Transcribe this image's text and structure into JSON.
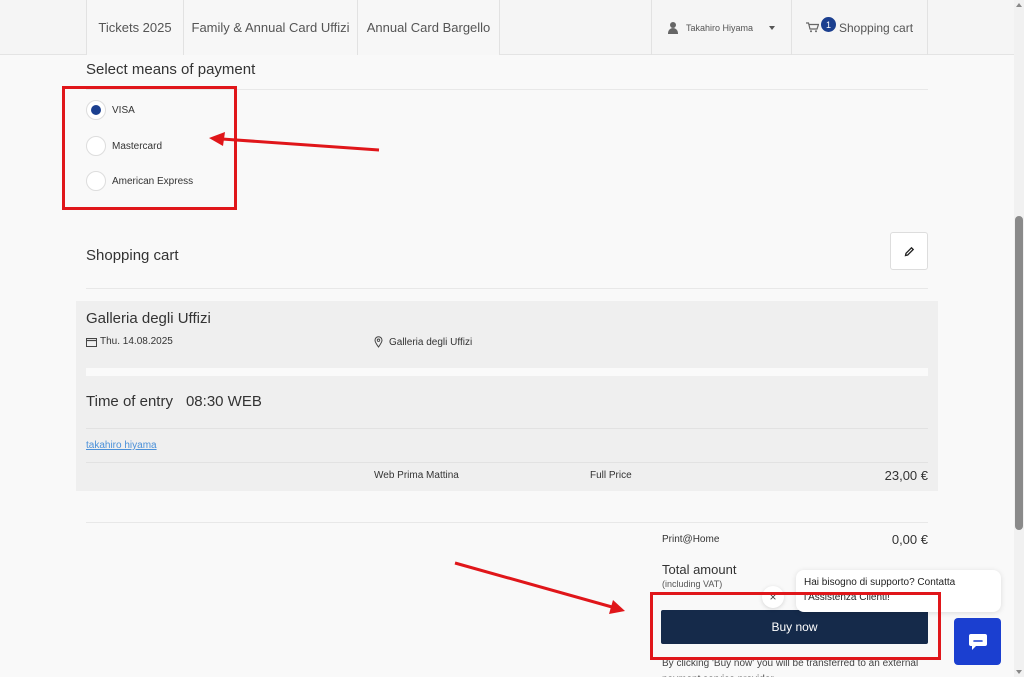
{
  "nav": {
    "tabs": [
      "Tickets 2025",
      "Family & Annual Card Uffizi",
      "Annual Card Bargello"
    ],
    "user_name": "Takahiro Hiyama",
    "cart_count": "1",
    "cart_label": "Shopping cart"
  },
  "payment": {
    "heading": "Select means of payment",
    "options": [
      "VISA",
      "Mastercard",
      "American Express"
    ],
    "selected": "VISA"
  },
  "cart": {
    "heading": "Shopping cart",
    "museum": "Galleria degli Uffizi",
    "date": "Thu. 14.08.2025",
    "location": "Galleria degli Uffizi",
    "entry_label": "Time of entry",
    "entry_time": "08:30 WEB",
    "holder": "takahiro hiyama",
    "ticket_type": "Web Prima Mattina",
    "rate": "Full Price",
    "price": "23,00 €"
  },
  "summary": {
    "print_label": "Print@Home",
    "print_price": "0,00 €",
    "total_label": "Total amount",
    "vat_note": "(including VAT)",
    "buy_label": "Buy now",
    "disclaimer": "By clicking 'Buy now' you will be transferred to an external payment service provider."
  },
  "support": {
    "message": "Hai bisogno di supporto? Contatta l'Assistenza Clienti!",
    "close_glyph": "×"
  },
  "colors": {
    "accent": "#1b3f8f",
    "buy_button": "#152a4a",
    "annotation": "#e0161a",
    "chat_button": "#1b3fd0",
    "link": "#4a90d9"
  }
}
